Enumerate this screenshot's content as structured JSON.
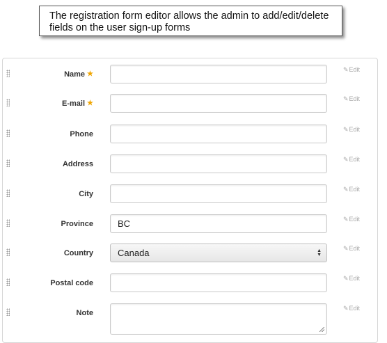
{
  "callout": {
    "text": "The registration form editor allows the admin to add/edit/delete fields on the user sign-up forms"
  },
  "form": {
    "required_marker": "★",
    "edit_label": "Edit",
    "fields": [
      {
        "label": "Name",
        "required": true,
        "type": "text",
        "value": ""
      },
      {
        "label": "E-mail",
        "required": true,
        "type": "text",
        "value": ""
      },
      {
        "label": "Phone",
        "required": false,
        "type": "text",
        "value": ""
      },
      {
        "label": "Address",
        "required": false,
        "type": "text",
        "value": ""
      },
      {
        "label": "City",
        "required": false,
        "type": "text",
        "value": ""
      },
      {
        "label": "Province",
        "required": false,
        "type": "text",
        "value": "BC"
      },
      {
        "label": "Country",
        "required": false,
        "type": "select",
        "value": "Canada"
      },
      {
        "label": "Postal code",
        "required": false,
        "type": "text",
        "value": ""
      },
      {
        "label": "Note",
        "required": false,
        "type": "textarea",
        "value": ""
      }
    ]
  },
  "colors": {
    "required_marker": "#f0a500",
    "edit_link": "#a8a8a8",
    "label": "#333333"
  }
}
